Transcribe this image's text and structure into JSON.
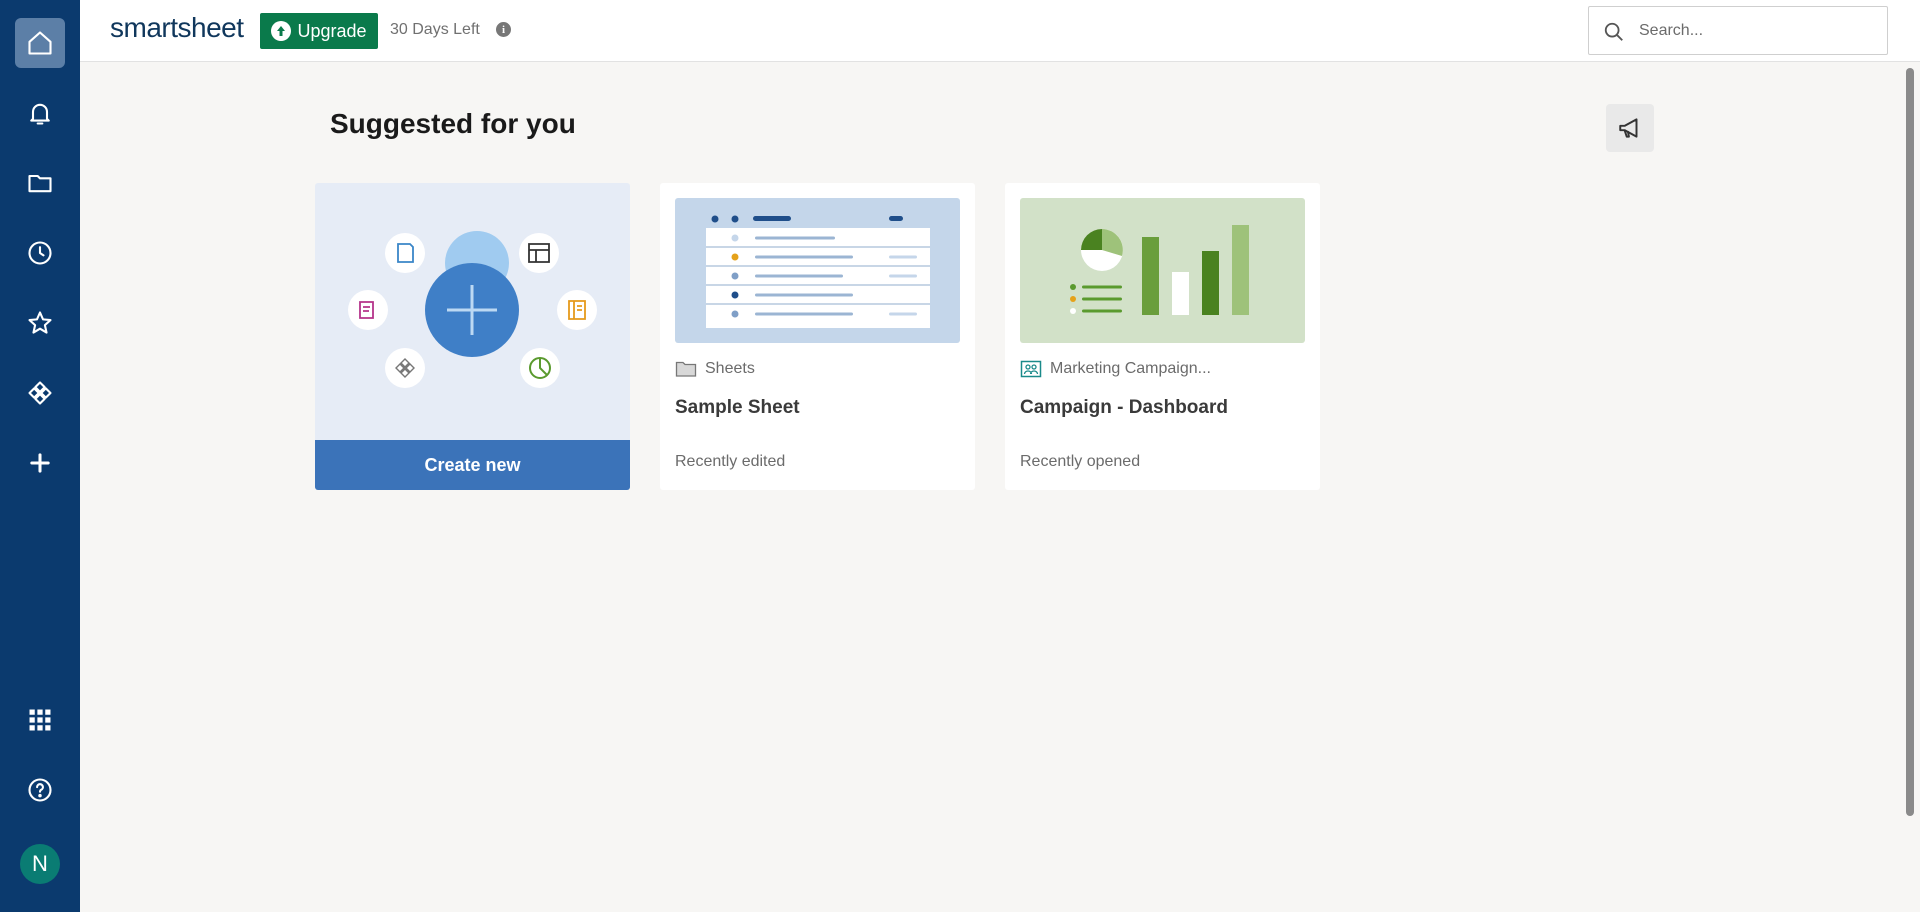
{
  "app": {
    "logo": "smartsheet",
    "upgrade_label": "Upgrade",
    "trial_status": "30 Days Left"
  },
  "search": {
    "placeholder": "Search..."
  },
  "rail": {
    "items": [
      "home-icon",
      "bell-icon",
      "folder-icon",
      "clock-icon",
      "star-icon",
      "workapps-icon",
      "plus-icon"
    ],
    "bottom_items": [
      "app-grid-icon",
      "help-icon"
    ],
    "avatar_initial": "N"
  },
  "main": {
    "title": "Suggested for you",
    "cards": [
      {
        "type": "create",
        "button_label": "Create new"
      },
      {
        "type": "sheet",
        "location": "Sheets",
        "title": "Sample Sheet",
        "status": "Recently edited"
      },
      {
        "type": "dashboard",
        "location": "Marketing Campaign...",
        "title": "Campaign - Dashboard",
        "status": "Recently opened"
      }
    ]
  },
  "colors": {
    "rail_bg": "#0b3a6e",
    "upgrade_green": "#0a7a4b",
    "create_blue": "#3b73b9",
    "avatar_teal": "#0a7c73"
  }
}
